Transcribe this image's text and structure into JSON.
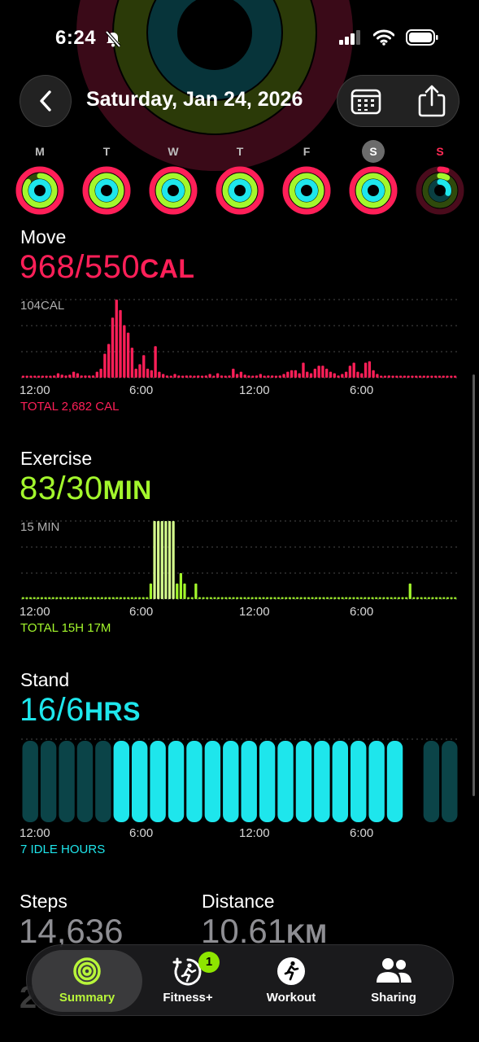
{
  "status_bar": {
    "time": "6:24"
  },
  "header": {
    "title": "Saturday, Jan 24, 2026"
  },
  "week": [
    {
      "letter": "M",
      "move": 1.05,
      "exercise": 0.85,
      "stand": 1.0,
      "state": "normal"
    },
    {
      "letter": "T",
      "move": 1.35,
      "exercise": 1.6,
      "stand": 1.3,
      "state": "normal"
    },
    {
      "letter": "W",
      "move": 1.55,
      "exercise": 1.8,
      "stand": 1.2,
      "state": "normal"
    },
    {
      "letter": "T",
      "move": 1.25,
      "exercise": 1.3,
      "stand": 1.1,
      "state": "normal"
    },
    {
      "letter": "F",
      "move": 1.3,
      "exercise": 1.7,
      "stand": 1.2,
      "state": "normal"
    },
    {
      "letter": "S",
      "move": 1.76,
      "exercise": 2.77,
      "stand": 2.67,
      "state": "selected"
    },
    {
      "letter": "S",
      "move": 0.05,
      "exercise": 0.08,
      "stand": 0.3,
      "state": "today"
    }
  ],
  "move": {
    "label": "Move",
    "value": "968/550",
    "unit": "CAL",
    "top_label": "104CAL",
    "total": "TOTAL 2,682 CAL",
    "color": "#ff1f58",
    "max": 104,
    "hourly": [
      2,
      2,
      2,
      2,
      2,
      2,
      2,
      2,
      3,
      6,
      4,
      3,
      4,
      8,
      6,
      3,
      3,
      3,
      3,
      8,
      12,
      32,
      45,
      80,
      104,
      90,
      70,
      60,
      40,
      12,
      18,
      30,
      12,
      10,
      42,
      8,
      5,
      3,
      2,
      5,
      3,
      2,
      3,
      3,
      2,
      3,
      2,
      3,
      5,
      2,
      6,
      3,
      2,
      3,
      12,
      5,
      8,
      4,
      3,
      2,
      3,
      5,
      2,
      3,
      3,
      2,
      3,
      5,
      8,
      10,
      10,
      6,
      20,
      8,
      6,
      12,
      16,
      16,
      12,
      8,
      6,
      3,
      5,
      8,
      16,
      20,
      8,
      6,
      20,
      22,
      10,
      5,
      2,
      2,
      3,
      2,
      2,
      2,
      2,
      2,
      2,
      2,
      2,
      2,
      2,
      2,
      2,
      2,
      2,
      2,
      2,
      2
    ]
  },
  "exercise": {
    "label": "Exercise",
    "value": "83/30",
    "unit": "MIN",
    "top_label": "15 MIN",
    "total": "TOTAL 15H 17M",
    "color": "#a3f72c",
    "max": 15,
    "hourly": [
      0,
      0,
      0,
      0,
      0,
      0,
      0,
      0,
      0,
      0,
      0,
      0,
      0,
      0,
      0,
      0,
      0,
      0,
      0,
      0,
      0,
      0,
      0,
      0,
      0,
      0,
      0,
      0,
      0,
      0,
      0,
      0,
      0,
      0,
      3,
      15,
      15,
      15,
      15,
      15,
      15,
      3,
      5,
      3,
      0,
      0,
      3,
      0,
      0,
      0,
      0,
      0,
      0,
      0,
      0,
      0,
      0,
      0,
      0,
      0,
      0,
      0,
      0,
      0,
      0,
      0,
      0,
      0,
      0,
      0,
      0,
      0,
      0,
      0,
      0,
      0,
      0,
      0,
      0,
      0,
      0,
      0,
      0,
      0,
      0,
      0,
      0,
      0,
      0,
      0,
      0,
      0,
      0,
      0,
      0,
      0,
      0,
      0,
      0,
      0,
      0,
      0,
      0,
      3,
      0,
      0,
      0,
      0,
      0,
      0,
      0,
      0,
      0,
      0,
      0,
      0
    ]
  },
  "stand": {
    "label": "Stand",
    "value": "16/6",
    "unit": "HRS",
    "idle": "7 IDLE HOURS",
    "color": "#1ee6ec",
    "hours": [
      0,
      0,
      0,
      0,
      0,
      1,
      1,
      1,
      1,
      1,
      1,
      1,
      1,
      1,
      1,
      1,
      1,
      1,
      1,
      1,
      1,
      -1,
      0,
      0
    ]
  },
  "axis": {
    "labels": [
      "12:00",
      "6:00",
      "12:00",
      "6:00"
    ]
  },
  "stats": {
    "steps_label": "Steps",
    "steps_value": "14,636",
    "distance_label": "Distance",
    "distance_value": "10.61",
    "distance_unit": "KM",
    "ghost": "21"
  },
  "tabs": [
    {
      "label": "Summary",
      "icon": "activity-rings-icon",
      "selected": true
    },
    {
      "label": "Fitness+",
      "icon": "fitness-plus-icon",
      "badge": "1"
    },
    {
      "label": "Workout",
      "icon": "workout-runner-icon"
    },
    {
      "label": "Sharing",
      "icon": "sharing-people-icon"
    }
  ]
}
